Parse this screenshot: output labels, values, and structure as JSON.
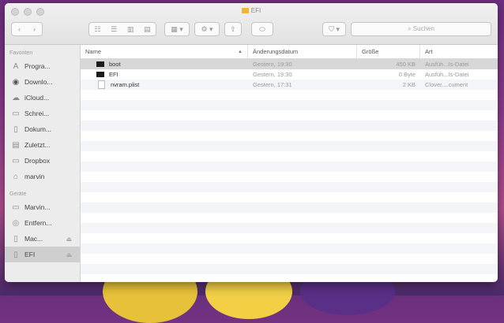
{
  "window": {
    "title": "EFI"
  },
  "toolbar": {
    "back": "‹",
    "forward": "›",
    "view_icons": "☷",
    "view_list": "☰",
    "view_columns": "▥",
    "view_cover": "▤",
    "arrange": "▦ ▾",
    "action": "⚙ ▾",
    "share": "⇧",
    "tags": "⬭",
    "dropbox": "⛉ ▾",
    "search_placeholder": "Suchen",
    "search_icon": "⌕"
  },
  "sidebar": {
    "favorites_heading": "Favoriten",
    "favorites": [
      {
        "label": "Progra...",
        "icon": "apps-icon",
        "glyph": "A"
      },
      {
        "label": "Downlo...",
        "icon": "downloads-icon",
        "glyph": "◉"
      },
      {
        "label": "iCloud...",
        "icon": "cloud-icon",
        "glyph": "☁"
      },
      {
        "label": "Schrei...",
        "icon": "desktop-icon",
        "glyph": "▭"
      },
      {
        "label": "Dokum...",
        "icon": "documents-icon",
        "glyph": "▯"
      },
      {
        "label": "Zuletzt...",
        "icon": "recents-icon",
        "glyph": "▤"
      },
      {
        "label": "Dropbox",
        "icon": "folder-icon",
        "glyph": "▭"
      },
      {
        "label": "marvin",
        "icon": "home-icon",
        "glyph": "⌂"
      }
    ],
    "devices_heading": "Geräte",
    "devices": [
      {
        "label": "Marvin...",
        "icon": "laptop-icon",
        "glyph": "▭",
        "eject": ""
      },
      {
        "label": "Entfern...",
        "icon": "disc-icon",
        "glyph": "◎",
        "eject": ""
      },
      {
        "label": "Mac...",
        "icon": "drive-icon",
        "glyph": "▯",
        "eject": "⏏"
      },
      {
        "label": "EFI",
        "icon": "drive-icon",
        "glyph": "▯",
        "eject": "⏏"
      }
    ]
  },
  "columns": {
    "name": "Name",
    "date": "Änderungsdatum",
    "size": "Größe",
    "kind": "Art",
    "sort_indicator": "▲"
  },
  "files": [
    {
      "name": "boot",
      "date": "Gestern, 19:30",
      "size": "450 KB",
      "kind": "Ausfüh...Is-Datei",
      "icon": "exec"
    },
    {
      "name": "EFI",
      "date": "Gestern, 19:30",
      "size": "0 Byte",
      "kind": "Ausfüh...Is-Datei",
      "icon": "exec"
    },
    {
      "name": "nvram.plist",
      "date": "Gestern, 17:31",
      "size": "2 KB",
      "kind": "Clover....cument",
      "icon": "doc"
    }
  ]
}
